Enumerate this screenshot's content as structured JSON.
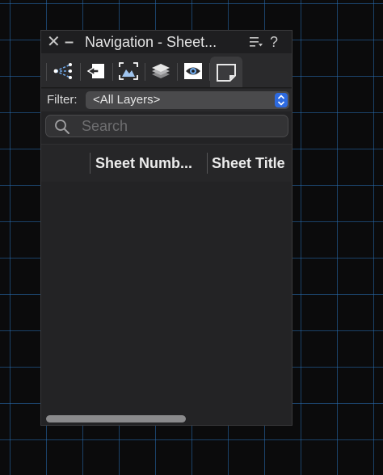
{
  "palette": {
    "title": "Navigation - Sheet...",
    "close_symbol": "✕",
    "collapse_symbol": "–",
    "help_symbol": "?"
  },
  "tabs": [
    {
      "name": "classes",
      "icon": "classes-icon"
    },
    {
      "name": "design-layers",
      "icon": "design-layers-icon"
    },
    {
      "name": "saved-views",
      "icon": "saved-views-icon"
    },
    {
      "name": "layers",
      "icon": "layers-stack-icon"
    },
    {
      "name": "viewports",
      "icon": "viewport-eye-icon"
    },
    {
      "name": "sheet-layers",
      "icon": "sheet-layer-icon",
      "active": true
    }
  ],
  "filter": {
    "label": "Filter:",
    "value": "<All Layers>"
  },
  "search": {
    "placeholder": "Search",
    "value": ""
  },
  "table": {
    "columns": [
      "",
      "Sheet Numb...",
      "Sheet Title"
    ],
    "rows": []
  },
  "colors": {
    "accent": "#2d6ae0",
    "panel_bg": "#232325",
    "grid_line": "#286eb4"
  }
}
